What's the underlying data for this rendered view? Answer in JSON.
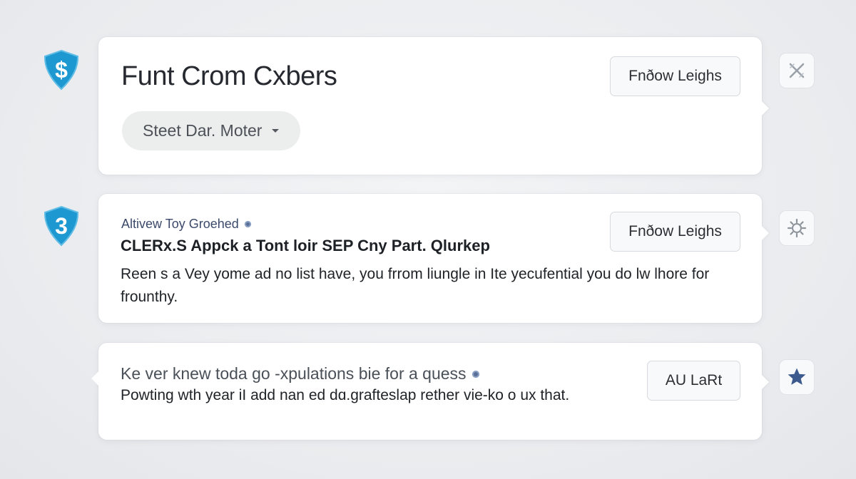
{
  "cards": [
    {
      "title": "Funt Crom Cxbers",
      "dropdown": "Steet Dar. Moter",
      "button": "Fnðow Leighs"
    },
    {
      "meta": "Altivew Toy Groehed",
      "headline": "CLERx.S Appck a Tont loir SEP Cny Part. Qlurkep",
      "body": "Reen s a Vey yome ad no list have, you frrom liungle in Ite yecufential you do lw lhore for frounthy.",
      "button": "Fnðow Leighs"
    },
    {
      "question": "Ke ver knew toda go -xpulations bie for a quess",
      "body": "Powting wth year iI add nan ed dɑ.grafteslap rether vie-ko o ux that.",
      "button": "AU LaRt"
    }
  ],
  "badges": [
    "$",
    "3"
  ],
  "colors": {
    "badge": "#1e98d0",
    "star": "#3d5a8f",
    "background": "#eceef1"
  },
  "icons": [
    "shield-dollar-icon",
    "shield-number-icon",
    "close-icon",
    "gear-icon",
    "star-icon"
  ]
}
